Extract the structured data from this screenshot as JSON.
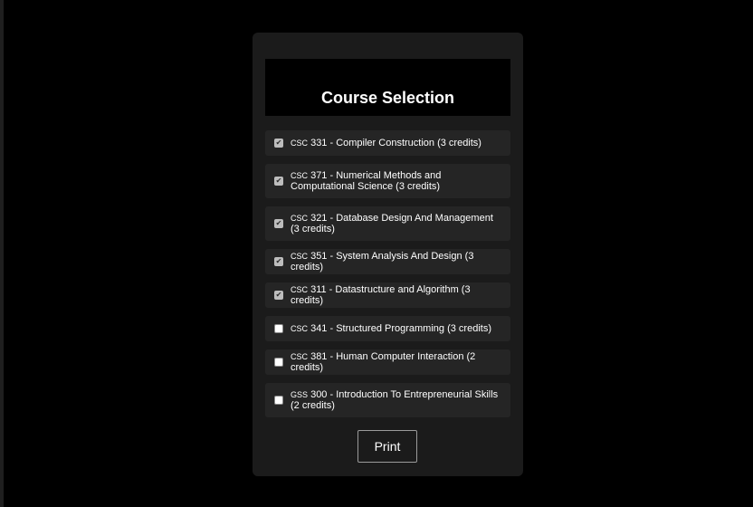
{
  "form": {
    "title": "Course Selection",
    "print_label": "Print"
  },
  "courses": [
    {
      "code": "CSC",
      "rest": " 331 - Compiler Construction (3 credits)",
      "checked": true,
      "lines": 1
    },
    {
      "code": "CSC",
      "rest": " 371 - Numerical Methods and Computational Science (3 credits)",
      "checked": true,
      "lines": 2
    },
    {
      "code": "CSC",
      "rest": " 321 - Database Design And Management (3 credits)",
      "checked": true,
      "lines": 2
    },
    {
      "code": "CSC",
      "rest": " 351 - System Analysis And Design (3 credits)",
      "checked": true,
      "lines": 1
    },
    {
      "code": "CSC",
      "rest": " 311 - Datastructure and Algorithm (3 credits)",
      "checked": true,
      "lines": 1
    },
    {
      "code": "CSC",
      "rest": " 341 - Structured Programming (3 credits)",
      "checked": false,
      "lines": 1
    },
    {
      "code": "CSC",
      "rest": " 381 - Human Computer Interaction (2 credits)",
      "checked": false,
      "lines": 1
    },
    {
      "code": "GSS",
      "rest": " 300 - Introduction To Entrepreneurial Skills (2 credits)",
      "checked": false,
      "lines": 2
    }
  ],
  "colors": {
    "page_background": "#000000",
    "panel_background": "#1b1b1b",
    "item_background": "#252525",
    "text": "#ffffff"
  }
}
